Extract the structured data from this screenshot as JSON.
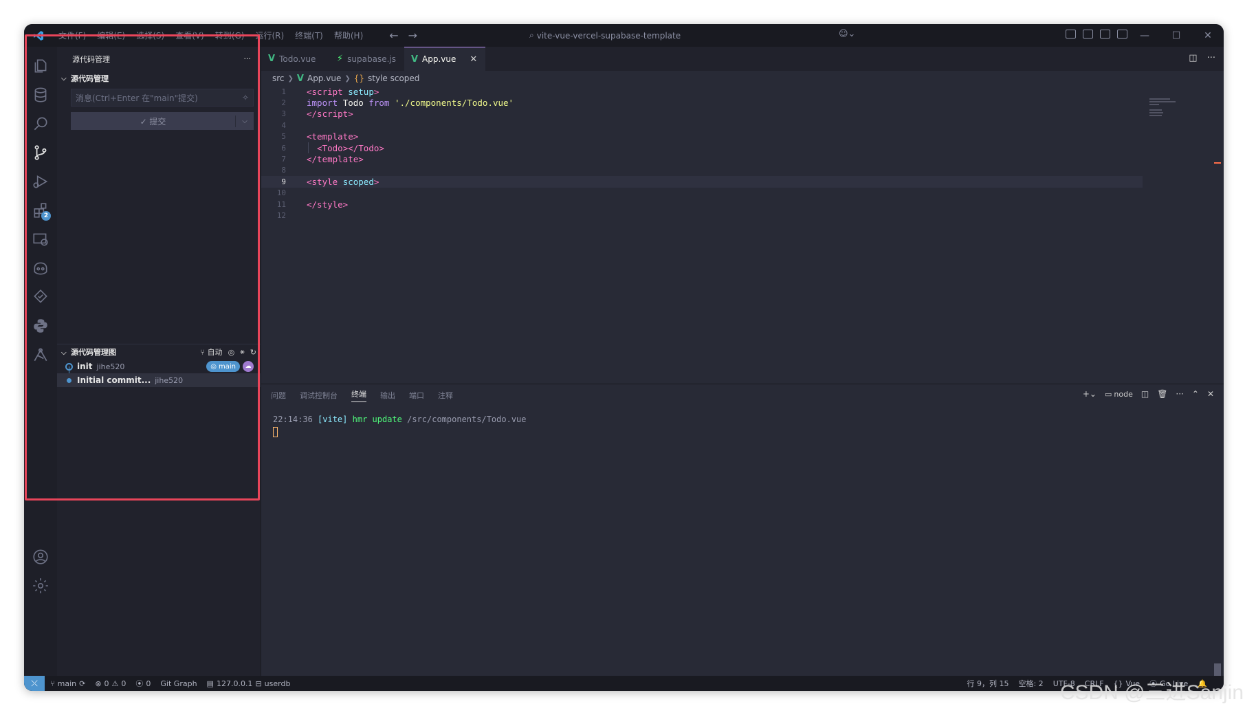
{
  "titlebar": {
    "menu": [
      "文件(F)",
      "编辑(E)",
      "选择(S)",
      "查看(V)",
      "转到(G)",
      "运行(R)",
      "终端(T)",
      "帮助(H)"
    ],
    "search_text": "vite-vue-vercel-supabase-template"
  },
  "activitybar": {
    "extensions_badge": "2"
  },
  "sidebar": {
    "title": "源代码管理",
    "section_title": "源代码管理",
    "commit_placeholder": "消息(Ctrl+Enter 在\"main\"提交)",
    "commit_button": "✓ 提交",
    "graph_title": "源代码管理图",
    "graph_auto": "自动",
    "commits": [
      {
        "message": "init",
        "author": "jihe520",
        "branch": "main"
      },
      {
        "message": "Initial commit...",
        "author": "jihe520"
      }
    ]
  },
  "editor": {
    "tabs": [
      {
        "label": "Todo.vue",
        "kind": "vue",
        "active": false
      },
      {
        "label": "supabase.js",
        "kind": "js",
        "active": false
      },
      {
        "label": "App.vue",
        "kind": "vue",
        "active": true
      }
    ],
    "breadcrumb": {
      "folder": "src",
      "file": "App.vue",
      "symbol": "style scoped"
    },
    "current_line": 9
  },
  "panel": {
    "tabs": [
      "问题",
      "调试控制台",
      "终端",
      "输出",
      "端口",
      "注释"
    ],
    "active_tab": "终端",
    "terminal_name": "node",
    "terminal": {
      "time": "22:14:36",
      "tag": "[vite]",
      "action": "hmr update",
      "path": "/src/components/Todo.vue"
    }
  },
  "statusbar": {
    "branch": "main",
    "errors": "0",
    "warnings": "0",
    "ports": "0",
    "git_graph": "Git Graph",
    "db": "127.0.0.1",
    "db_name": "userdb",
    "position": "行 9，列 15",
    "spaces": "空格: 2",
    "encoding": "UTF-8",
    "eol": "CRLF",
    "lang": "Vue",
    "golive": "Go Live"
  },
  "watermark": "CSDN @三进Sanjin",
  "colors": {
    "accent": "#4e94ce",
    "annotation": "#e8455a",
    "background": "#282a36"
  }
}
